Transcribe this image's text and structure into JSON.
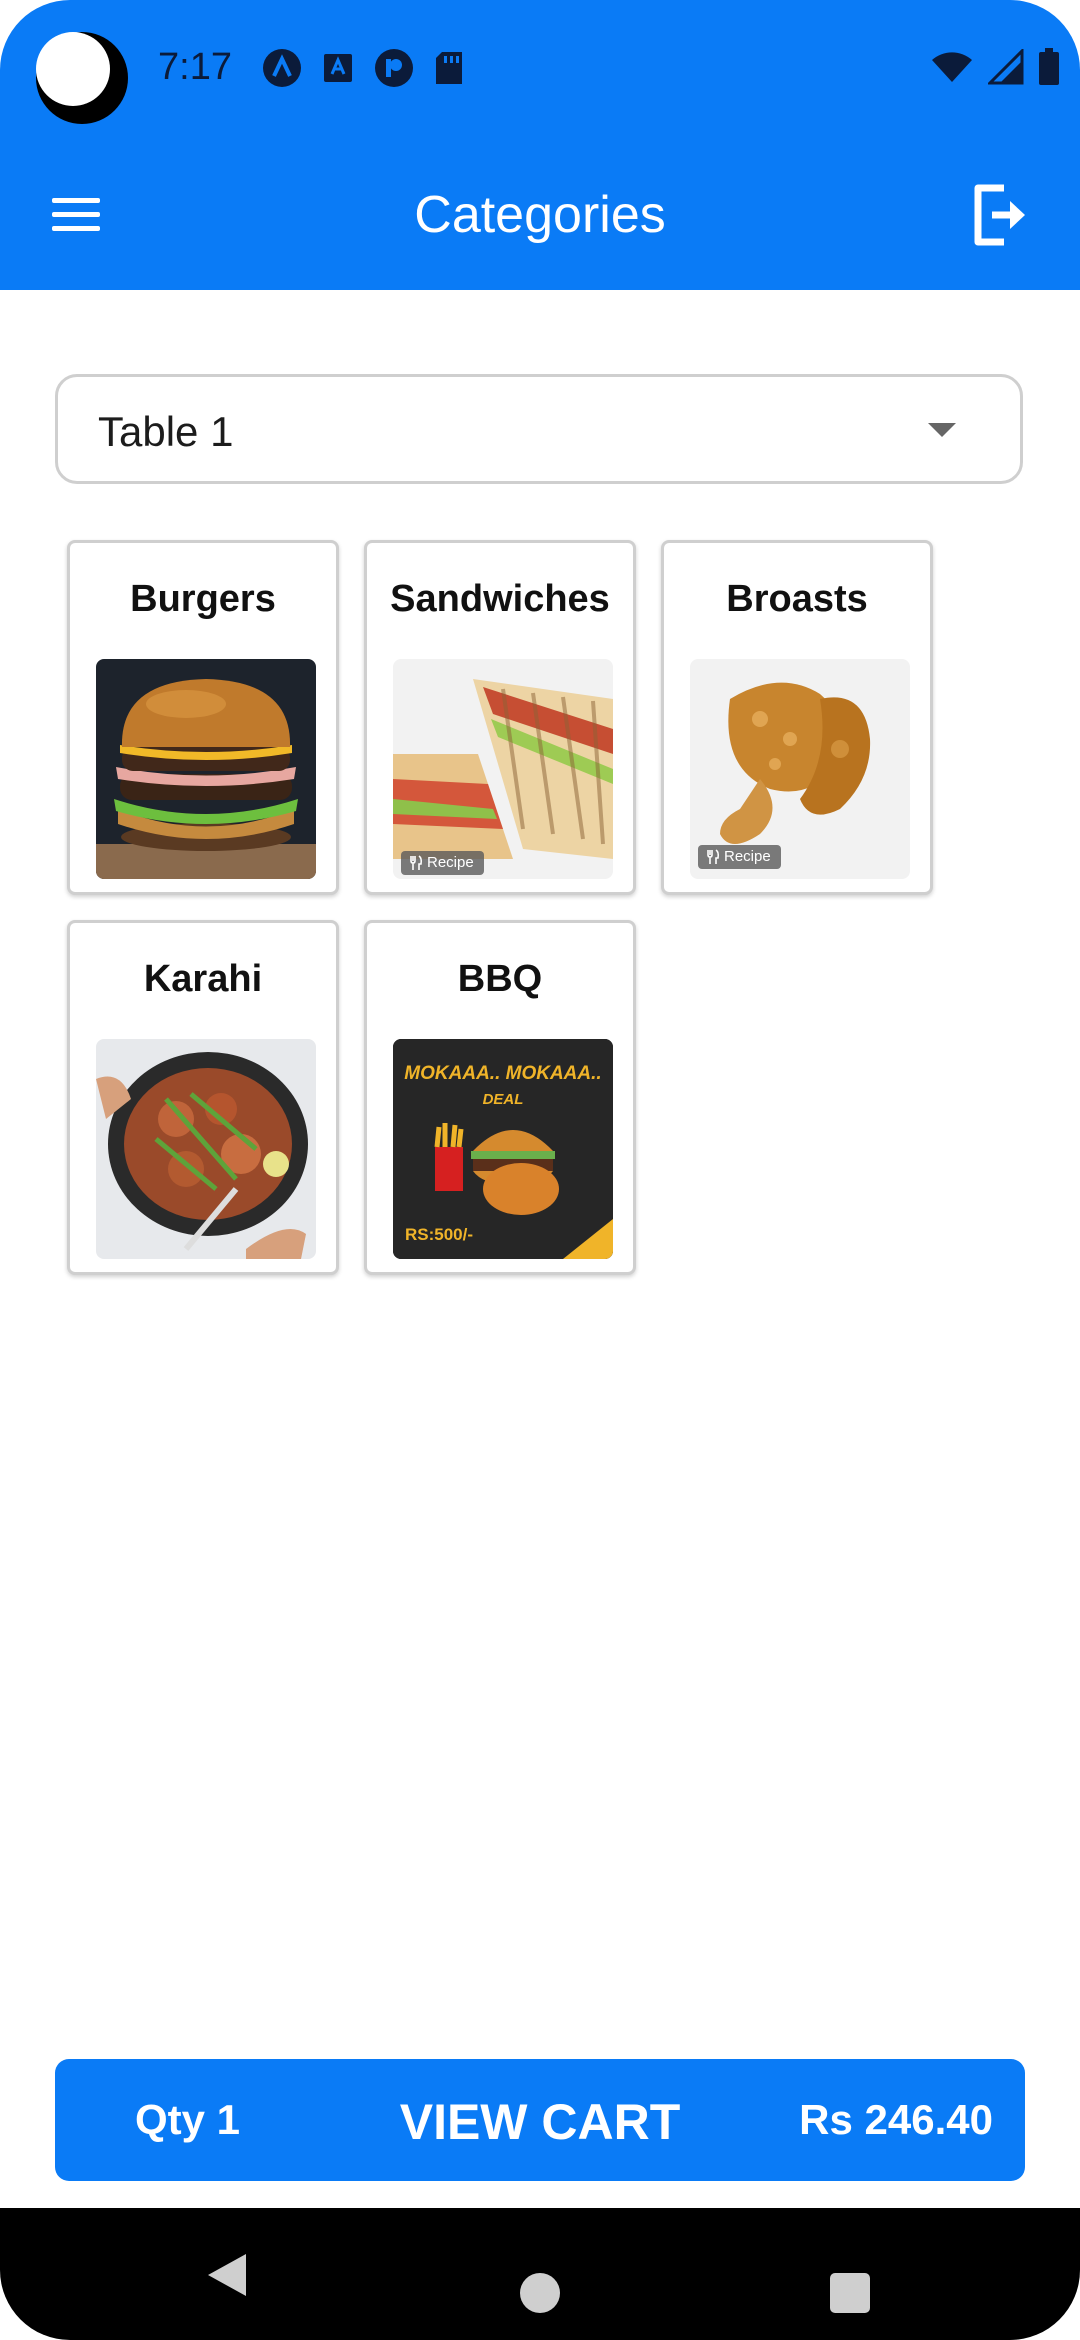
{
  "status_bar": {
    "time": "7:17",
    "left_icons": [
      "app-a-icon",
      "text-a-icon",
      "p-badge-icon",
      "sd-card-icon"
    ],
    "right_icons": [
      "wifi-icon",
      "signal-icon",
      "battery-icon"
    ]
  },
  "app_bar": {
    "title": "Categories",
    "menu_icon": "hamburger-menu-icon",
    "logout_icon": "logout-icon",
    "color": "#0a7bf6"
  },
  "table_select": {
    "value": "Table 1"
  },
  "categories": [
    {
      "name": "Burgers",
      "recipe_tag": ""
    },
    {
      "name": "Sandwiches",
      "recipe_tag": "Recipe"
    },
    {
      "name": "Broasts",
      "recipe_tag": "Recipe"
    },
    {
      "name": "Karahi",
      "recipe_tag": ""
    },
    {
      "name": "BBQ",
      "recipe_tag": ""
    }
  ],
  "bbq_promo": {
    "headline_1": "MOKAAA.. MOKAAA..",
    "headline_2": "DEAL",
    "price": "RS:500/-"
  },
  "cart": {
    "qty_label": "Qty 1",
    "button_label": "VIEW CART",
    "total": "Rs 246.40"
  },
  "nav_bar": {
    "icons": [
      "back-triangle-icon",
      "home-circle-icon",
      "recents-square-icon"
    ]
  }
}
